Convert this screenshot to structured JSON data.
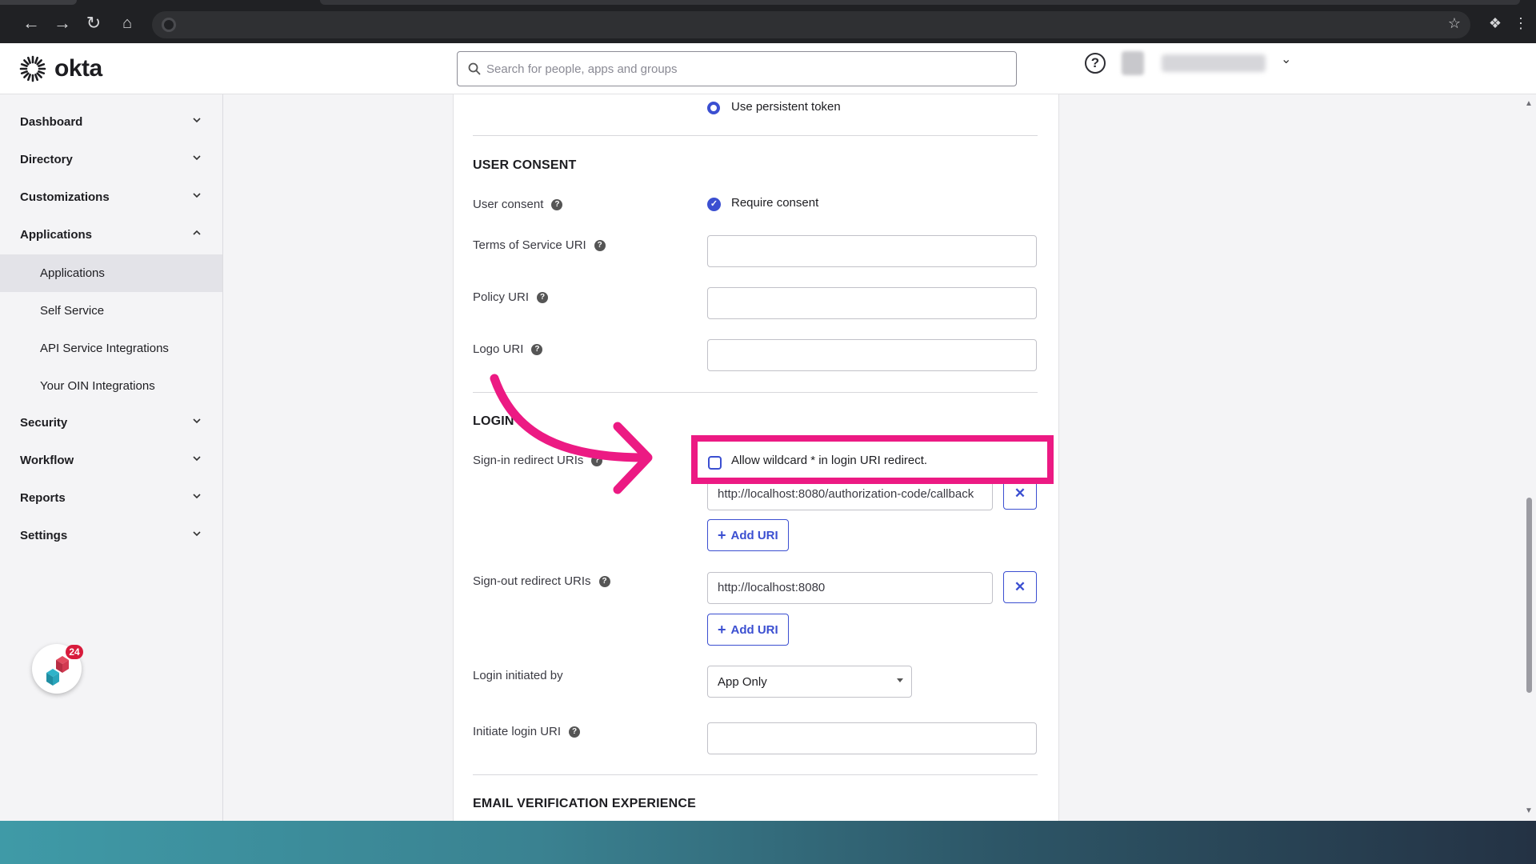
{
  "brand": {
    "name": "okta",
    "accent": "#3b4fd1",
    "highlight": "#ec1a83"
  },
  "header": {
    "search_placeholder": "Search for people, apps and groups",
    "help_label": "?"
  },
  "sidebar": {
    "items": [
      {
        "label": "Dashboard",
        "expanded": false
      },
      {
        "label": "Directory",
        "expanded": false
      },
      {
        "label": "Customizations",
        "expanded": false
      },
      {
        "label": "Applications",
        "expanded": true
      },
      {
        "label": "Security",
        "expanded": false
      },
      {
        "label": "Workflow",
        "expanded": false
      },
      {
        "label": "Reports",
        "expanded": false
      },
      {
        "label": "Settings",
        "expanded": false
      }
    ],
    "applications_sub": [
      {
        "label": "Applications",
        "active": true
      },
      {
        "label": "Self Service",
        "active": false
      },
      {
        "label": "API Service Integrations",
        "active": false
      },
      {
        "label": "Your OIN Integrations",
        "active": false
      }
    ],
    "helper_count": "24"
  },
  "form": {
    "refresh_token": {
      "option_label": "Use persistent token",
      "selected": true
    },
    "user_consent": {
      "title": "USER CONSENT",
      "consent_label": "User consent",
      "consent_option": "Require consent",
      "consent_checked": true,
      "tos_label": "Terms of Service URI",
      "tos_value": "",
      "policy_label": "Policy URI",
      "policy_value": "",
      "logo_label": "Logo URI",
      "logo_value": ""
    },
    "login": {
      "title": "LOGIN",
      "signin_label": "Sign-in redirect URIs",
      "wildcard_label": "Allow wildcard * in login URI redirect.",
      "wildcard_checked": false,
      "signin_uri": "http://localhost:8080/authorization-code/callback",
      "add_uri_label": "Add URI",
      "signout_label": "Sign-out redirect URIs",
      "signout_uri": "http://localhost:8080",
      "initiated_by_label": "Login initiated by",
      "initiated_by_value": "App Only",
      "initiate_uri_label": "Initiate login URI",
      "initiate_uri_value": ""
    },
    "email_verification": {
      "title": "EMAIL VERIFICATION EXPERIENCE"
    }
  }
}
